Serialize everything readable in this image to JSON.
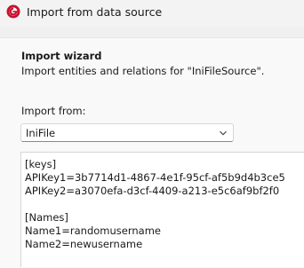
{
  "window": {
    "title": "Import from data source",
    "icon": "app-logo-icon"
  },
  "wizard": {
    "heading": "Import wizard",
    "description": "Import entities and relations for \"IniFileSource\"."
  },
  "import_from": {
    "label": "Import from:",
    "selected": "IniFile"
  },
  "content": {
    "lines": [
      "[keys]",
      "APIKey1=3b7714d1-4867-4e1f-95cf-af5b9d4b3ce5",
      "APIKey2=a3070efa-d3cf-4409-a213-e5c6af9bf2f0",
      "",
      "[Names]",
      "Name1=randomusername",
      "Name2=newusername"
    ]
  },
  "colors": {
    "icon_red": "#c8102e"
  }
}
